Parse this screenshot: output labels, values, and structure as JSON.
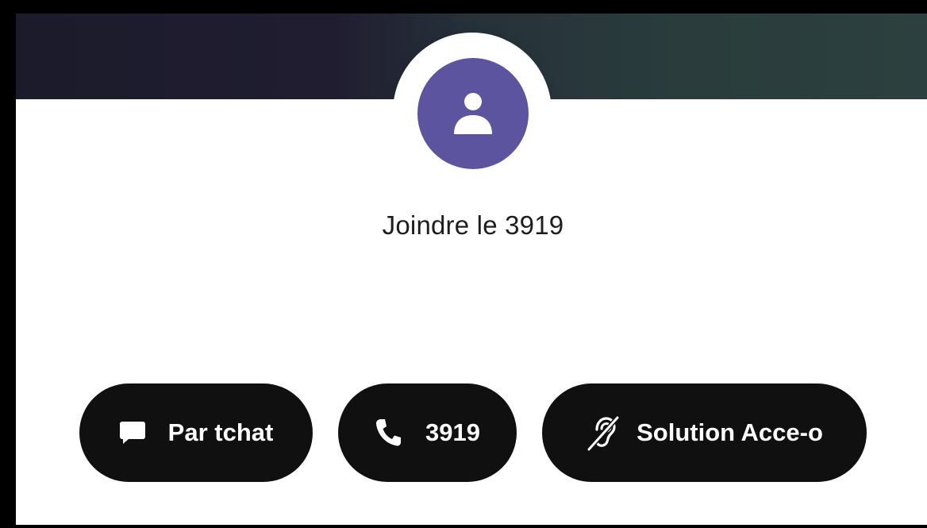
{
  "contact": {
    "title": "Joindre le 3919",
    "avatar_icon": "user-icon",
    "avatar_color": "#5d54a0"
  },
  "actions": [
    {
      "label": "Par tchat",
      "icon": "chat-bubble-icon"
    },
    {
      "label": "3919",
      "icon": "phone-icon"
    },
    {
      "label": "Solution Acce-o",
      "icon": "hearing-impaired-icon"
    }
  ]
}
